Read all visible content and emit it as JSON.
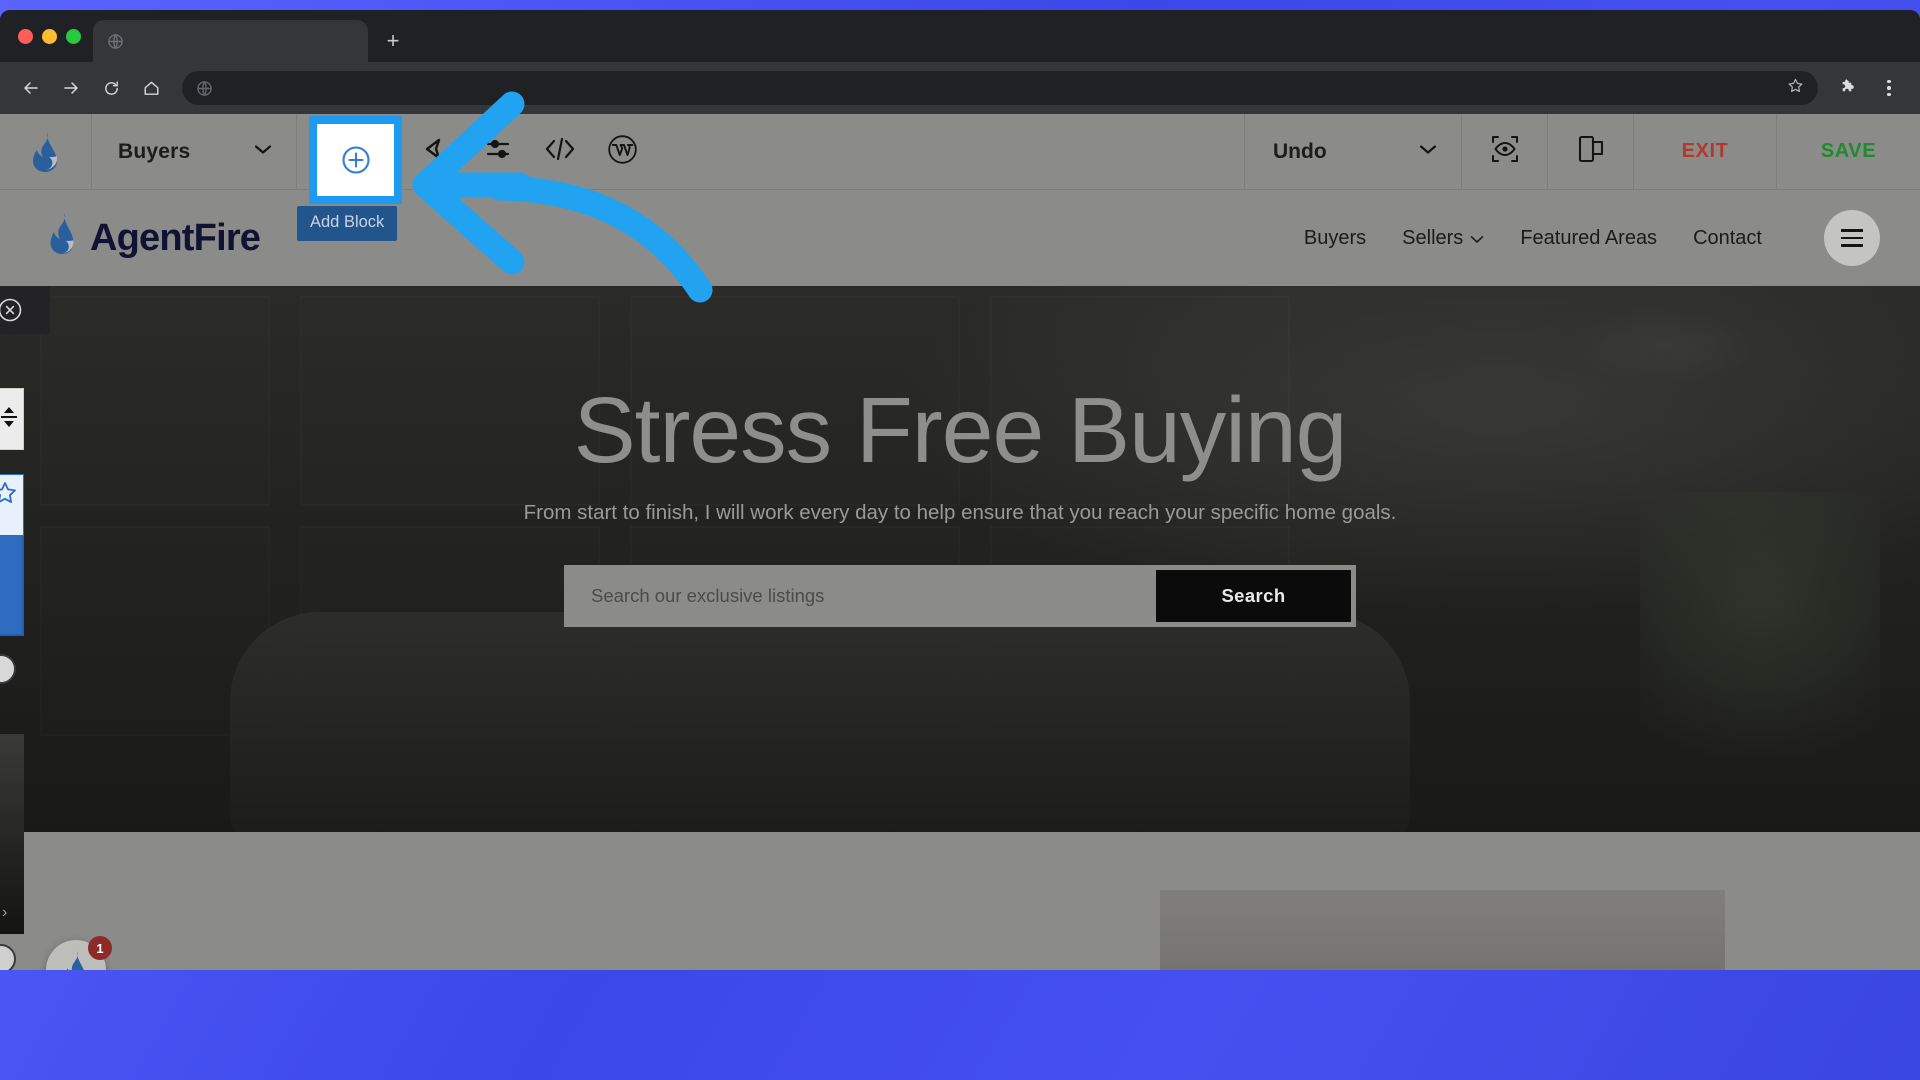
{
  "browser": {
    "tab": {
      "title": "",
      "favicon_icon": "globe-icon"
    },
    "new_tab_label": "+",
    "back_icon": "back-arrow-icon",
    "forward_icon": "forward-arrow-icon",
    "reload_icon": "reload-icon",
    "home_icon": "home-icon",
    "address_value": "",
    "address_placeholder": "",
    "bookmark_icon": "star-icon",
    "extensions_icon": "puzzle-piece-icon",
    "menu_icon": "kebab-menu-icon"
  },
  "builder_toolbar": {
    "logo_icon": "agentfire-flame-icon",
    "page_select": {
      "value": "Buyers",
      "chevron_icon": "chevron-down-icon"
    },
    "tools": [
      {
        "name": "add-block",
        "label": "Add Block",
        "icon": "add-block-icon",
        "highlighted": true
      },
      {
        "name": "design",
        "icon": "palette-icon"
      },
      {
        "name": "settings",
        "icon": "sliders-icon"
      },
      {
        "name": "code",
        "icon": "code-brackets-icon"
      },
      {
        "name": "wordpress",
        "icon": "wordpress-icon"
      }
    ],
    "tooltip": "Add Block",
    "undo": {
      "label": "Undo",
      "chevron_icon": "chevron-down-icon"
    },
    "preview_icon": "preview-eye-icon",
    "responsive_icon": "layout-copy-icon",
    "exit_label": "EXIT",
    "save_label": "SAVE",
    "exit_color": "#b33a2b",
    "save_color": "#1f8a2e",
    "highlight_color": "#1e9bf0"
  },
  "site_header": {
    "brand": "AgentFire",
    "brand_icon": "flame-logo-icon",
    "nav": [
      {
        "label": "Buyers",
        "has_chevron": false
      },
      {
        "label": "Sellers",
        "has_chevron": true
      },
      {
        "label": "Featured Areas",
        "has_chevron": false
      },
      {
        "label": "Contact",
        "has_chevron": false
      }
    ],
    "menu_icon": "hamburger-menu-icon"
  },
  "hero": {
    "title": "Stress Free Buying",
    "subtitle": "From start to finish, I will work every day to help ensure that you reach your specific home goals.",
    "search_placeholder": "Search our exclusive listings",
    "search_value": "",
    "search_button": "Search"
  },
  "left_drawer": {
    "close_icon": "close-circle-icon",
    "items": [
      {
        "name": "drag-handle-tile",
        "icon": "move-vertical-icon"
      },
      {
        "name": "favorite-tile",
        "icon": "star-icon",
        "selected": true
      },
      {
        "name": "info-circle",
        "icon": "info-circle-icon"
      },
      {
        "name": "expand-chevron",
        "icon": "chevron-right-icon"
      }
    ]
  },
  "chat_widget": {
    "icon": "flame-chat-icon",
    "badge": "1"
  },
  "annotation": {
    "type": "curved-arrow",
    "color": "#22a3f2",
    "points_to": "add-block"
  }
}
